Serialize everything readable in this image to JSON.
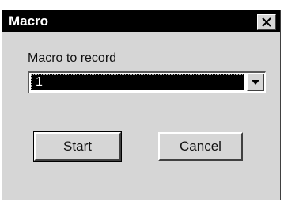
{
  "window": {
    "title": "Macro",
    "close_icon": "close-icon"
  },
  "form": {
    "label": "Macro to record",
    "selected_value": "1",
    "dropdown_icon": "chevron-down-icon"
  },
  "buttons": {
    "start_label": "Start",
    "cancel_label": "Cancel"
  },
  "colors": {
    "titlebar": "#000000",
    "title_text": "#ffffff",
    "face": "#d6d6d6",
    "selection": "#000000"
  }
}
